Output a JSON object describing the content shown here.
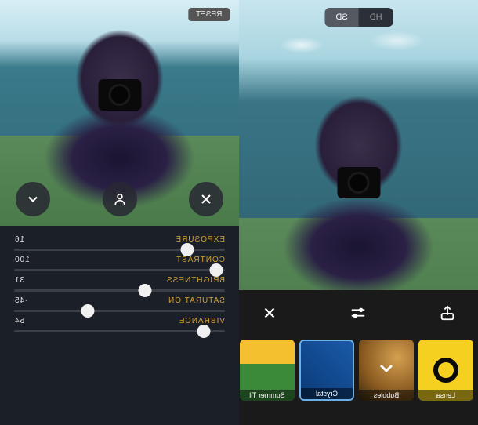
{
  "left": {
    "reset_label": "RESET",
    "actions": {
      "collapse": "chevron-down",
      "subject": "person-outline",
      "close": "close"
    },
    "sliders": [
      {
        "label": "EXPOSURE",
        "value": "16",
        "pos": 18
      },
      {
        "label": "CONTRAST",
        "value": "100",
        "pos": 4
      },
      {
        "label": "BRIGHTNESS",
        "value": "31",
        "pos": 38
      },
      {
        "label": "SATURATION",
        "value": "-45",
        "pos": 65
      },
      {
        "label": "VIBRANCE",
        "value": "54",
        "pos": 10
      }
    ]
  },
  "right": {
    "quality": {
      "hd": "HD",
      "sd": "SD",
      "active": "sd"
    },
    "controls": {
      "share": "share",
      "adjust": "sliders",
      "close": "close"
    },
    "filters": [
      {
        "name": "Lensa",
        "kind": "lensa"
      },
      {
        "name": "Bubbles",
        "kind": "bubbles"
      },
      {
        "name": "Crystal",
        "kind": "crystal"
      },
      {
        "name": "Summer Til",
        "kind": "summer"
      }
    ]
  }
}
